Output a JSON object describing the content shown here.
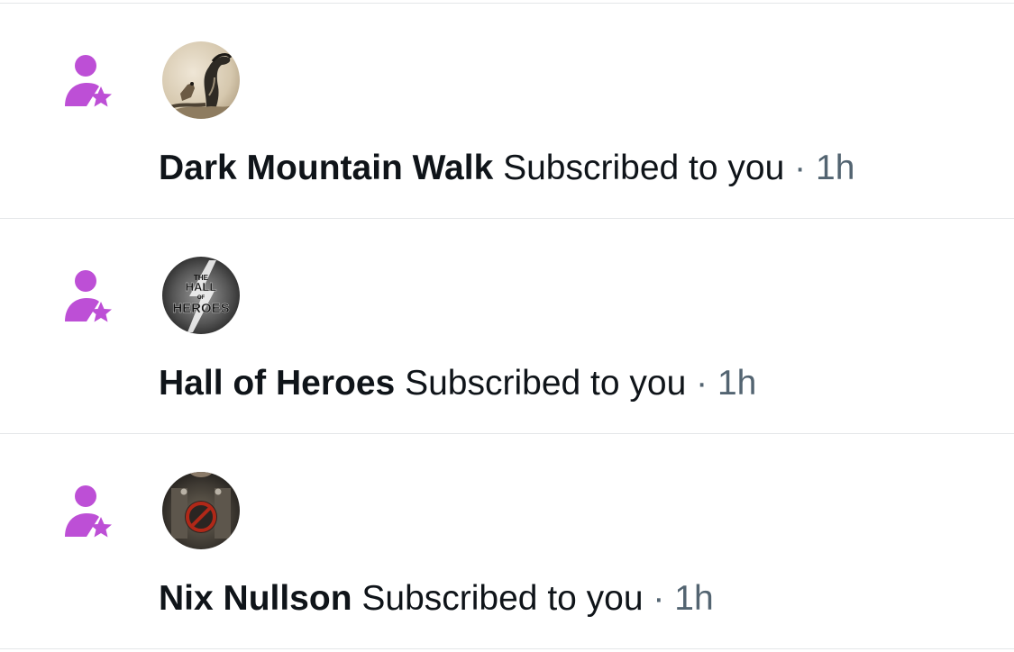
{
  "colors": {
    "accent": "#bd4fd6",
    "text": "#0f1419",
    "secondary": "#536471",
    "divider": "#e4e6e8"
  },
  "notifications": [
    {
      "icon": "subscriber-star-icon",
      "avatar": "snake-photo-avatar",
      "name": "Dark Mountain Walk",
      "action": "Subscribed to you",
      "separator": "·",
      "time": "1h"
    },
    {
      "icon": "subscriber-star-icon",
      "avatar": "hall-of-heroes-logo-avatar",
      "name": "Hall of Heroes",
      "action": "Subscribed to you",
      "separator": "·",
      "time": "1h"
    },
    {
      "icon": "subscriber-star-icon",
      "avatar": "no-symbol-armor-avatar",
      "name": "Nix Nullson",
      "action": "Subscribed to you",
      "separator": "·",
      "time": "1h"
    }
  ],
  "avatar_logo": {
    "line1": "THE",
    "line2": "HALL",
    "line3": "OF",
    "line4": "HEROES"
  }
}
